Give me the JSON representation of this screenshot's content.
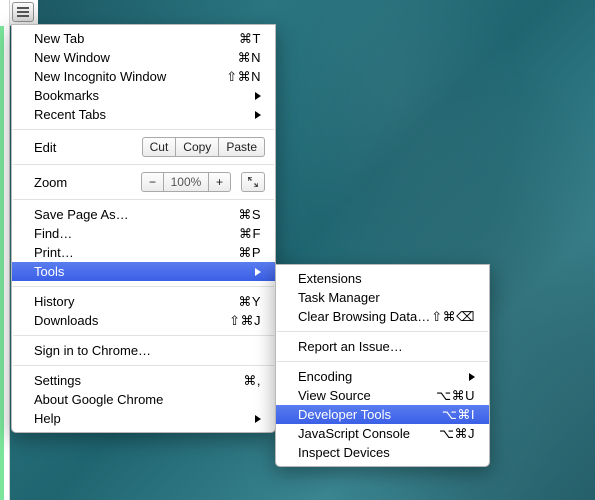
{
  "main_menu": {
    "new_tab": {
      "label": "New Tab",
      "shortcut": "⌘T"
    },
    "new_window": {
      "label": "New Window",
      "shortcut": "⌘N"
    },
    "new_incognito": {
      "label": "New Incognito Window",
      "shortcut": "⇧⌘N"
    },
    "bookmarks": {
      "label": "Bookmarks"
    },
    "recent_tabs": {
      "label": "Recent Tabs"
    },
    "edit": {
      "label": "Edit",
      "cut": "Cut",
      "copy": "Copy",
      "paste": "Paste"
    },
    "zoom": {
      "label": "Zoom",
      "value": "100%"
    },
    "save_as": {
      "label": "Save Page As…",
      "shortcut": "⌘S"
    },
    "find": {
      "label": "Find…",
      "shortcut": "⌘F"
    },
    "print": {
      "label": "Print…",
      "shortcut": "⌘P"
    },
    "tools": {
      "label": "Tools"
    },
    "history": {
      "label": "History",
      "shortcut": "⌘Y"
    },
    "downloads": {
      "label": "Downloads",
      "shortcut": "⇧⌘J"
    },
    "signin": {
      "label": "Sign in to Chrome…"
    },
    "settings": {
      "label": "Settings",
      "shortcut": "⌘,"
    },
    "about": {
      "label": "About Google Chrome"
    },
    "help": {
      "label": "Help"
    }
  },
  "sub_menu": {
    "extensions": {
      "label": "Extensions"
    },
    "task_manager": {
      "label": "Task Manager"
    },
    "clear_data": {
      "label": "Clear Browsing Data…",
      "shortcut": "⇧⌘⌫"
    },
    "report_issue": {
      "label": "Report an Issue…"
    },
    "encoding": {
      "label": "Encoding"
    },
    "view_source": {
      "label": "View Source",
      "shortcut": "⌥⌘U"
    },
    "dev_tools": {
      "label": "Developer Tools",
      "shortcut": "⌥⌘I"
    },
    "js_console": {
      "label": "JavaScript Console",
      "shortcut": "⌥⌘J"
    },
    "inspect_devices": {
      "label": "Inspect Devices"
    }
  }
}
